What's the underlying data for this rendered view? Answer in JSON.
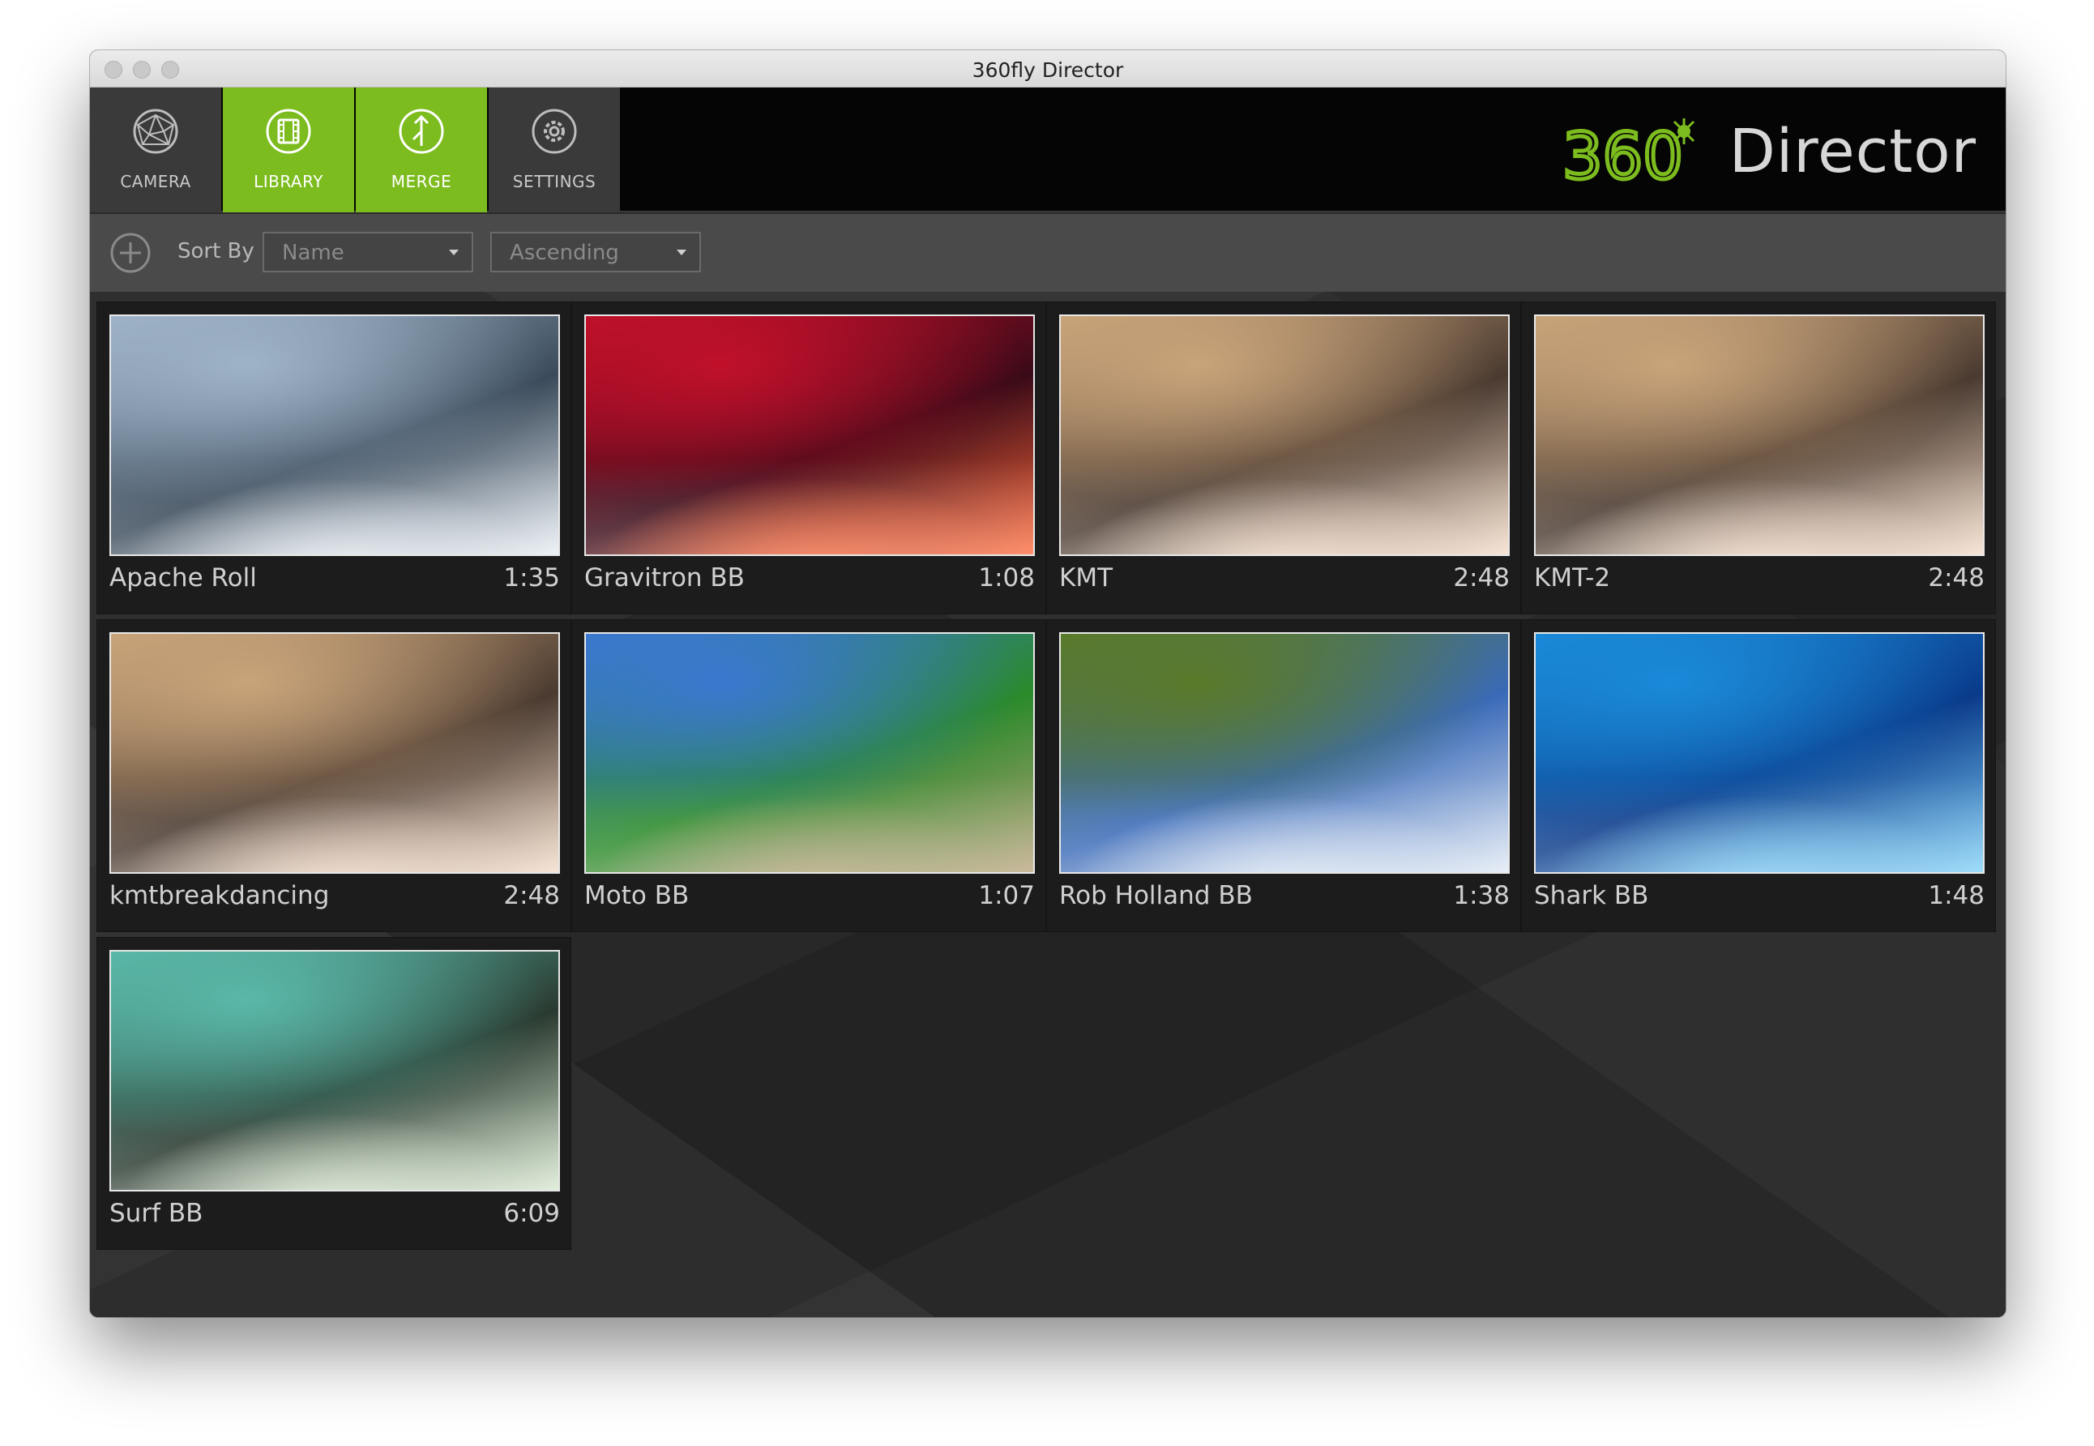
{
  "window": {
    "title": "360fly Director"
  },
  "nav": {
    "tabs": [
      {
        "label": "CAMERA",
        "icon": "camera-sphere-icon",
        "active": false
      },
      {
        "label": "LIBRARY",
        "icon": "library-film-icon",
        "active": true
      },
      {
        "label": "MERGE",
        "icon": "merge-icon",
        "active": true
      },
      {
        "label": "SETTINGS",
        "icon": "gear-icon",
        "active": false
      }
    ]
  },
  "brand": {
    "logo_text": "360",
    "name": "Director",
    "accent": "#7cbc1f"
  },
  "toolbar": {
    "add_icon": "plus-circle-icon",
    "sort_label": "Sort By",
    "sort_field": "Name",
    "sort_order": "Ascending"
  },
  "library": {
    "videos": [
      {
        "title": "Apache Roll",
        "duration": "1:35",
        "colors": [
          "#9fb3c8",
          "#e8eef4",
          "#3a4a5a"
        ]
      },
      {
        "title": "Gravitron BB",
        "duration": "1:08",
        "colors": [
          "#c0102a",
          "#ff6a3a",
          "#3a0a18"
        ]
      },
      {
        "title": "KMT",
        "duration": "2:48",
        "colors": [
          "#c9a47a",
          "#f3dcc8",
          "#4a3a30"
        ]
      },
      {
        "title": "KMT-2",
        "duration": "2:48",
        "colors": [
          "#c9a47a",
          "#f3dcc8",
          "#4a3a30"
        ]
      },
      {
        "title": "kmtbreakdancing",
        "duration": "2:48",
        "colors": [
          "#c9a47a",
          "#f3dcc8",
          "#4a3a30"
        ]
      },
      {
        "title": "Moto BB",
        "duration": "1:07",
        "colors": [
          "#3a78d0",
          "#b8a27a",
          "#2a8a2a"
        ]
      },
      {
        "title": "Rob Holland BB",
        "duration": "1:38",
        "colors": [
          "#5a7a2a",
          "#dfe8f4",
          "#3a6ab8"
        ]
      },
      {
        "title": "Shark BB",
        "duration": "1:48",
        "colors": [
          "#1a8ad8",
          "#7fd0f8",
          "#0a3a8a"
        ]
      },
      {
        "title": "Surf BB",
        "duration": "6:09",
        "colors": [
          "#5ab8a8",
          "#d8e8d0",
          "#2a3a30"
        ]
      }
    ]
  }
}
